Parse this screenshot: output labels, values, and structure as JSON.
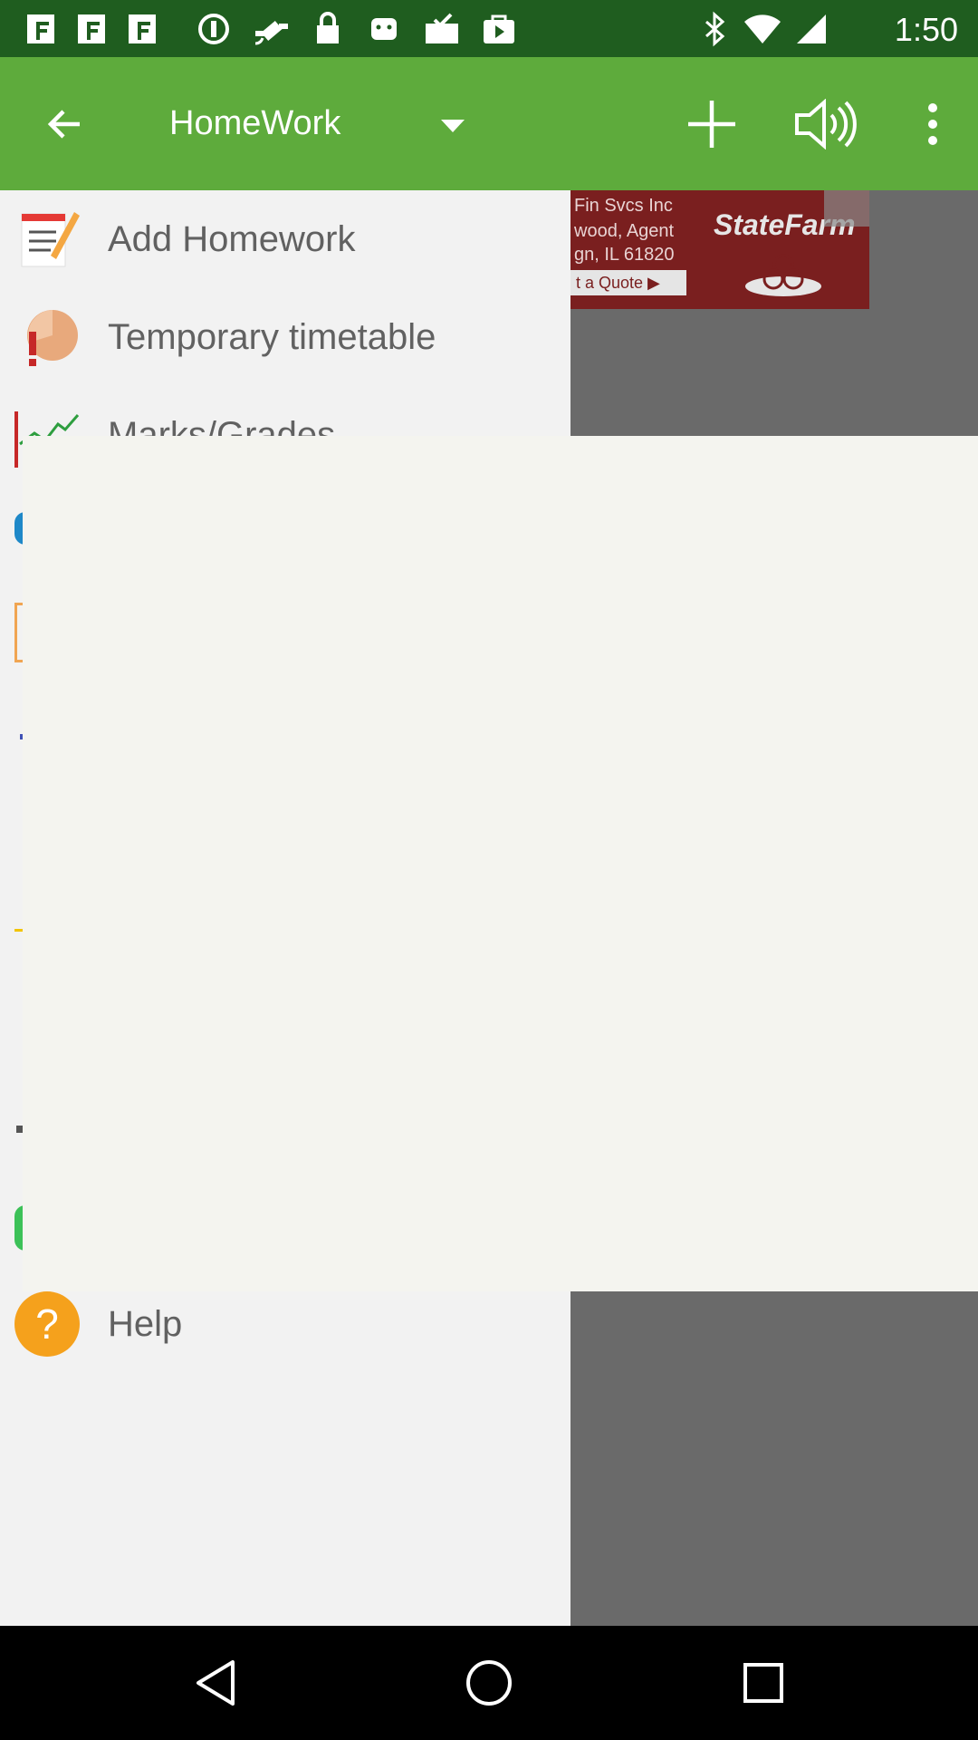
{
  "status_bar": {
    "time": "1:50",
    "left_icons": [
      "f-icon",
      "f-icon",
      "f-icon",
      "data-saver-icon",
      "fake-gps-icon",
      "lock-icon",
      "android-icon",
      "mail-check-icon",
      "play-store-icon"
    ],
    "right_icons": [
      "bluetooth-icon",
      "wifi-icon",
      "signal-icon"
    ]
  },
  "app_bar": {
    "title": "HomeWork",
    "color": "#5eab3c"
  },
  "ad": {
    "line1": "Fin Svcs Inc",
    "line2": "wood, Agent",
    "line3": "gn, IL 61820",
    "brand": "StateFarm",
    "cta": "t a Quote ▶"
  },
  "drawer": {
    "items": [
      {
        "label": "Add Homework",
        "icon": "notepad-pencil-icon"
      },
      {
        "label": "Temporary timetable",
        "icon": "pie-exclamation-icon"
      },
      {
        "label": "Marks/Grades",
        "icon": "chart-line-icon"
      },
      {
        "label": "Help",
        "icon": "help-circle-icon"
      }
    ]
  },
  "colors": {
    "status_bar": "#1f5d1f",
    "app_bar": "#5eab3c",
    "drawer_bg": "#f2f2f2",
    "scrim": "#6a6a6a",
    "overlay": "#f4f4ef"
  }
}
